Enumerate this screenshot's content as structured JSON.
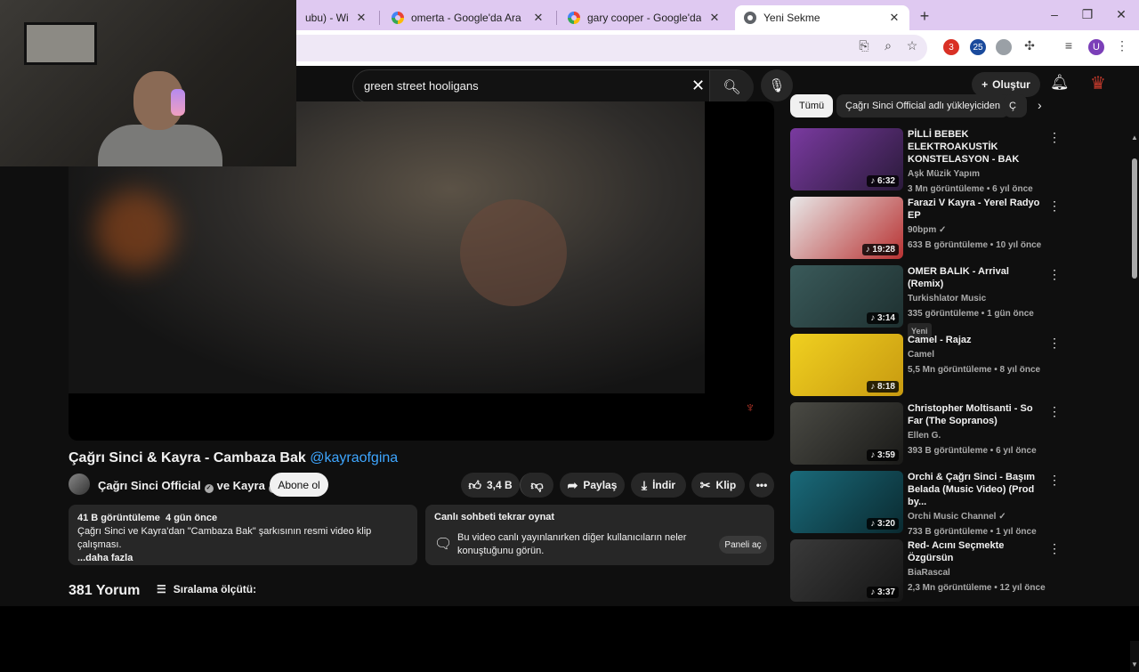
{
  "browser": {
    "tabs": [
      {
        "label": "ubu) - Wikiwan",
        "close": "✕"
      },
      {
        "label": "omerta - Google'da Ara",
        "close": "✕"
      },
      {
        "label": "gary cooper - Google'da Ara",
        "close": "✕"
      },
      {
        "label": "Yeni Sekme",
        "close": "✕"
      }
    ],
    "new_tab": "+",
    "window_controls": {
      "minimize": "–",
      "maximize": "❐",
      "close": "✕"
    },
    "extension_badges": {
      "one": "3",
      "two": "25"
    },
    "profile_initial": "U"
  },
  "youtube": {
    "search_value": "green street hooligans",
    "create_label": "Oluştur",
    "video": {
      "title": "Çağrı Sinci & Kayra - Cambaza Bak",
      "mention": "@kayraofgina",
      "channel": "Çağrı Sinci Official",
      "collab": "ve Kayra",
      "subscribe": "Abone ol",
      "likes": "3,4 B",
      "share": "Paylaş",
      "download": "İndir",
      "clip": "Klip"
    },
    "description": {
      "views": "41 B görüntüleme",
      "date": "4 gün önce",
      "text": "Çağrı Sinci ve Kayra'dan \"Cambaza Bak\" şarkısının resmi video klip çalışması.",
      "more": "...daha fazla"
    },
    "chat": {
      "title": "Canlı sohbeti tekrar oynat",
      "text": "Bu video canlı yayınlanırken diğer kullanıcıların neler konuştuğunu görün.",
      "button": "Paneli aç"
    },
    "comments": {
      "count": "381 Yorum",
      "sort": "Sıralama ölçütü:"
    },
    "chips": [
      "Tümü",
      "Çağrı Sinci Official adlı yükleyiciden",
      "Ç"
    ],
    "recommendations": [
      {
        "title": "PİLLİ BEBEK ELEKTROAKUSTİK KONSTELASYON - BAK",
        "channel": "Aşk Müzik Yapım",
        "meta": "3 Mn görüntüleme • 6 yıl önce",
        "duration": "♪ 6:32",
        "badge": "",
        "verified": false
      },
      {
        "title": "Farazi V Kayra - Yerel Radyo EP",
        "channel": "90bpm",
        "meta": "633 B görüntüleme • 10 yıl önce",
        "duration": "♪ 19:28",
        "badge": "",
        "verified": true
      },
      {
        "title": "OMER BALIK - Arrival (Remix)",
        "channel": "Turkishlator Music",
        "meta": "335 görüntüleme • 1 gün önce",
        "duration": "♪ 3:14",
        "badge": "Yeni",
        "verified": false
      },
      {
        "title": "Camel - Rajaz",
        "channel": "Camel",
        "meta": "5,5 Mn görüntüleme • 8 yıl önce",
        "duration": "♪ 8:18",
        "badge": "",
        "verified": false
      },
      {
        "title": "Christopher Moltisanti - So Far (The Sopranos)",
        "channel": "Ellen G.",
        "meta": "393 B görüntüleme • 6 yıl önce",
        "duration": "♪ 3:59",
        "badge": "",
        "verified": false
      },
      {
        "title": "Orchi & Çağrı Sinci - Başım Belada (Music Video) (Prod by...",
        "channel": "Orchi Music Channel",
        "meta": "733 B görüntüleme • 1 yıl önce",
        "duration": "♪ 3:20",
        "badge": "",
        "verified": true
      },
      {
        "title": "Red- Acını Seçmekte Özgürsün",
        "channel": "BiaRascal",
        "meta": "2,3 Mn görüntüleme • 12 yıl önce",
        "duration": "♪ 3:37",
        "badge": "",
        "verified": false
      }
    ]
  }
}
